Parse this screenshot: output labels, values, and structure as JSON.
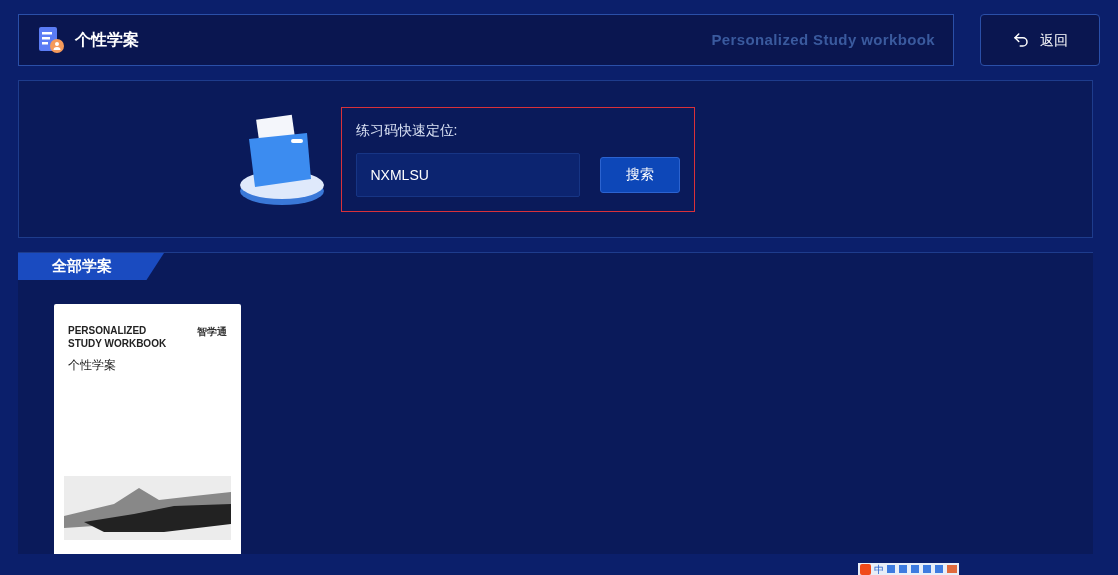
{
  "header": {
    "title": "个性学案",
    "subtitle": "Personalized Study workbook",
    "back": "返回"
  },
  "search": {
    "label": "练习码快速定位:",
    "value": "NXMLSU",
    "button": "搜索"
  },
  "section": {
    "tab": "全部学案",
    "books": [
      {
        "cover_title_lines": [
          "PERSONALIZED",
          "STUDY WORKBOOK"
        ],
        "cover_logo": "智学通",
        "cover_subtitle": "个性学案"
      }
    ]
  },
  "ime_toolbar": {
    "mode": "中"
  }
}
